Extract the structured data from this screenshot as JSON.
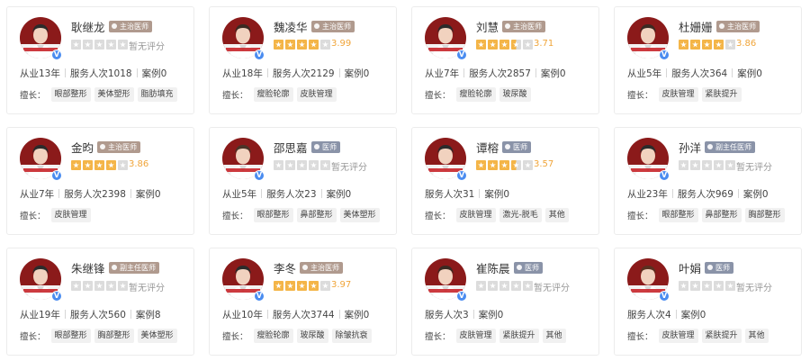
{
  "labels": {
    "specialty": "擅长：",
    "no_rating": "暂无评分"
  },
  "colors": {
    "star_on": "#f4b548",
    "star_off": "#dcdcdc",
    "badge_chief": "#b09a8e",
    "badge_other": "#8a93a8",
    "verified": "#4a8cf0"
  },
  "doctors": [
    {
      "name": "耿继龙",
      "title": "主治医师",
      "badge_color": "brown",
      "stars": 0,
      "rating": "暂无评分",
      "rated": false,
      "stats": [
        "从业13年",
        "服务人次1018",
        "案例0"
      ],
      "tags": [
        "眼部整形",
        "美体塑形",
        "脂肪填充"
      ],
      "verified": "V"
    },
    {
      "name": "魏凌华",
      "title": "主治医师",
      "badge_color": "brown",
      "stars": 3.99,
      "rating": "3.99",
      "rated": true,
      "stats": [
        "从业18年",
        "服务人次2129",
        "案例0"
      ],
      "tags": [
        "瘦脸轮廓",
        "皮肤管理"
      ],
      "verified": "V"
    },
    {
      "name": "刘慧",
      "title": "主治医师",
      "badge_color": "brown",
      "stars": 3.71,
      "rating": "3.71",
      "rated": true,
      "stats": [
        "从业7年",
        "服务人次2857",
        "案例0"
      ],
      "tags": [
        "瘦脸轮廓",
        "玻尿酸"
      ],
      "verified": "V"
    },
    {
      "name": "杜姗姗",
      "title": "主治医师",
      "badge_color": "brown",
      "stars": 3.86,
      "rating": "3.86",
      "rated": true,
      "stats": [
        "从业5年",
        "服务人次364",
        "案例0"
      ],
      "tags": [
        "皮肤管理",
        "紧肤提升"
      ],
      "verified": "V"
    },
    {
      "name": "金昀",
      "title": "主治医师",
      "badge_color": "brown",
      "stars": 3.86,
      "rating": "3.86",
      "rated": true,
      "stats": [
        "从业7年",
        "服务人次2398",
        "案例0"
      ],
      "tags": [
        "皮肤管理"
      ],
      "verified": "V"
    },
    {
      "name": "邵思嘉",
      "title": "医师",
      "badge_color": "slate",
      "stars": 0,
      "rating": "暂无评分",
      "rated": false,
      "stats": [
        "从业5年",
        "服务人次23",
        "案例0"
      ],
      "tags": [
        "眼部整形",
        "鼻部整形",
        "美体塑形"
      ],
      "verified": "V"
    },
    {
      "name": "谭榕",
      "title": "医师",
      "badge_color": "slate",
      "stars": 3.57,
      "rating": "3.57",
      "rated": true,
      "stats": [
        "服务人次31",
        "案例0"
      ],
      "tags": [
        "皮肤管理",
        "激光-脱毛",
        "其他"
      ],
      "verified": "V"
    },
    {
      "name": "孙洋",
      "title": "副主任医师",
      "badge_color": "slate",
      "stars": 0,
      "rating": "暂无评分",
      "rated": false,
      "stats": [
        "从业23年",
        "服务人次969",
        "案例0"
      ],
      "tags": [
        "眼部整形",
        "鼻部整形",
        "胸部整形"
      ],
      "verified": "V"
    },
    {
      "name": "朱继锋",
      "title": "副主任医师",
      "badge_color": "brown",
      "stars": 0,
      "rating": "暂无评分",
      "rated": false,
      "stats": [
        "从业19年",
        "服务人次560",
        "案例8"
      ],
      "tags": [
        "眼部整形",
        "胸部整形",
        "美体塑形"
      ],
      "verified": "V"
    },
    {
      "name": "李冬",
      "title": "主治医师",
      "badge_color": "brown",
      "stars": 3.97,
      "rating": "3.97",
      "rated": true,
      "stats": [
        "从业10年",
        "服务人次3744",
        "案例0"
      ],
      "tags": [
        "瘦脸轮廓",
        "玻尿酸",
        "除皱抗衰"
      ],
      "verified": "V"
    },
    {
      "name": "崔陈晨",
      "title": "医师",
      "badge_color": "slate",
      "stars": 0,
      "rating": "暂无评分",
      "rated": false,
      "stats": [
        "服务人次3",
        "案例0"
      ],
      "tags": [
        "皮肤管理",
        "紧肤提升",
        "其他"
      ],
      "verified": "V"
    },
    {
      "name": "叶娟",
      "title": "医师",
      "badge_color": "slate",
      "stars": 0,
      "rating": "暂无评分",
      "rated": false,
      "stats": [
        "服务人次4",
        "案例0"
      ],
      "tags": [
        "皮肤管理",
        "紧肤提升",
        "其他"
      ],
      "verified": "V"
    }
  ]
}
